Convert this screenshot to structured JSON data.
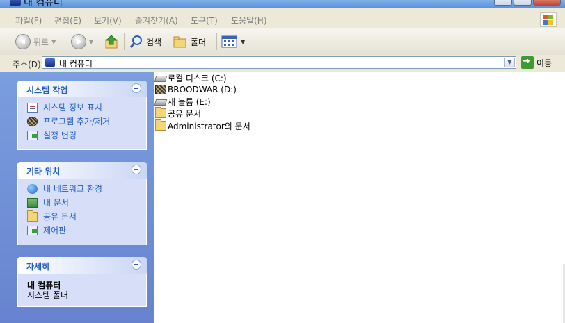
{
  "window": {
    "title": "내 컴퓨터"
  },
  "menu": [
    "파일(F)",
    "편집(E)",
    "보기(V)",
    "즐겨찾기(A)",
    "도구(T)",
    "도움말(H)"
  ],
  "toolbar": {
    "back_label": "뒤로",
    "search_label": "검색",
    "folders_label": "폴더"
  },
  "address": {
    "label": "주소(D)",
    "value": "내 컴퓨터",
    "go_label": "이동"
  },
  "panels": {
    "system_tasks": {
      "title": "시스템 작업",
      "items": [
        "시스템 정보 표시",
        "프로그램 추가/제거",
        "설정 변경"
      ]
    },
    "other_places": {
      "title": "기타 위치",
      "items": [
        "내 네트워크 환경",
        "내 문서",
        "공유 문서",
        "제어판"
      ]
    },
    "details": {
      "title": "자세히",
      "name": "내 컴퓨터",
      "type": "시스템 폴더"
    }
  },
  "files": [
    {
      "name": "로컬 디스크 (C:)",
      "icon": "hard-drive-icon"
    },
    {
      "name": "BROODWAR (D:)",
      "icon": "cd-drive-icon"
    },
    {
      "name": "새 볼륨 (E:)",
      "icon": "hard-drive-icon"
    },
    {
      "name": "공유 문서",
      "icon": "folder-icon"
    },
    {
      "name": "Administrator의 문서",
      "icon": "folder-icon"
    }
  ]
}
